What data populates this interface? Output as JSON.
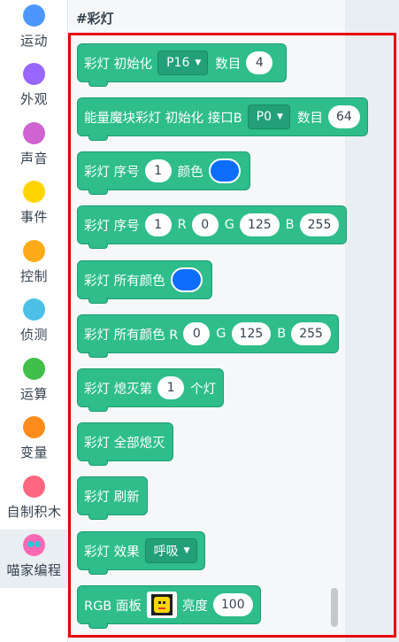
{
  "sidebar": {
    "items": [
      {
        "label": "运动",
        "color": "#4c97ff"
      },
      {
        "label": "外观",
        "color": "#9966ff"
      },
      {
        "label": "声音",
        "color": "#cf63cf"
      },
      {
        "label": "事件",
        "color": "#ffd500"
      },
      {
        "label": "控制",
        "color": "#ffab19"
      },
      {
        "label": "侦测",
        "color": "#4cbfe6"
      },
      {
        "label": "运算",
        "color": "#40bf4a"
      },
      {
        "label": "变量",
        "color": "#ff8c1a"
      },
      {
        "label": "自制积木",
        "color": "#ff6680"
      },
      {
        "label": "喵家编程",
        "color": "#ff69b4"
      }
    ],
    "selected": "喵家编程"
  },
  "flyout": {
    "section_title": "#彩灯",
    "blocks": {
      "b1": {
        "t1": "彩灯 初始化",
        "pin": "P16",
        "t2": "数目",
        "count": "4"
      },
      "b2": {
        "t1": "能量魔块彩灯 初始化 接口B",
        "port": "P0",
        "t2": "数目",
        "count": "64"
      },
      "b3": {
        "t1": "彩灯 序号",
        "index": "1",
        "t2": "颜色",
        "color": "#0d6efd"
      },
      "b4": {
        "t1": "彩灯 序号",
        "index": "1",
        "r_label": "R",
        "r": "0",
        "g_label": "G",
        "g": "125",
        "b_label": "B",
        "b": "255"
      },
      "b5": {
        "t1": "彩灯 所有颜色",
        "color": "#0d6efd"
      },
      "b6": {
        "t1": "彩灯 所有颜色 R",
        "r": "0",
        "g_label": "G",
        "g": "125",
        "b_label": "B",
        "b": "255"
      },
      "b7": {
        "t1": "彩灯 熄灭第",
        "index": "1",
        "t2": "个灯"
      },
      "b8": {
        "t1": "彩灯 全部熄灭"
      },
      "b9": {
        "t1": "彩灯 刷新"
      },
      "b10": {
        "t1": "彩灯 效果",
        "effect": "呼吸"
      },
      "b11": {
        "t1": "RGB 面板",
        "t2": "亮度",
        "brightness": "100"
      }
    },
    "block_color": "#2ebd8b",
    "highlight_color": "#e60000"
  }
}
